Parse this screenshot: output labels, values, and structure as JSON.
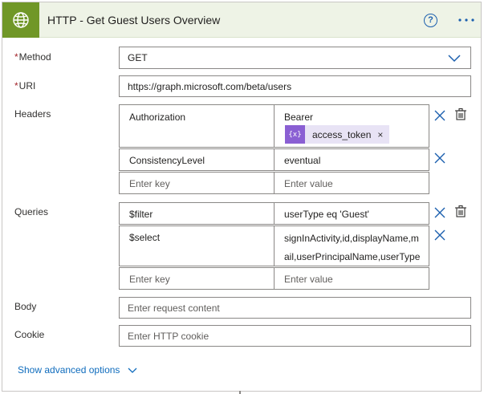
{
  "header": {
    "title": "HTTP - Get Guest Users Overview",
    "help_symbol": "?",
    "accent_color": "#709727",
    "icons": [
      "globe-icon",
      "help-icon",
      "more-options-icon"
    ]
  },
  "fields": {
    "method": {
      "required_mark": "*",
      "label": "Method",
      "value": "GET"
    },
    "uri": {
      "required_mark": "*",
      "label": "URI",
      "value": "https://graph.microsoft.com/beta/users"
    },
    "body": {
      "label": "Body",
      "placeholder": "Enter request content"
    },
    "cookie": {
      "label": "Cookie",
      "placeholder": "Enter HTTP cookie"
    }
  },
  "headers": {
    "label": "Headers",
    "rows": [
      {
        "key": "Authorization",
        "value": "Bearer"
      },
      {
        "key": "ConsistencyLevel",
        "value": "eventual"
      }
    ],
    "token": {
      "icon_text": "{x}",
      "label": "access_token",
      "remove": "×"
    },
    "new_key_placeholder": "Enter key",
    "new_value_placeholder": "Enter value"
  },
  "queries": {
    "label": "Queries",
    "rows": [
      {
        "key": "$filter",
        "value": "userType eq 'Guest'"
      },
      {
        "key": "$select",
        "value_line1": "signInActivity,id,displayName,m",
        "value_line2": "ail,userPrincipalName,userType"
      }
    ],
    "new_key_placeholder": "Enter key",
    "new_value_placeholder": "Enter value"
  },
  "footer": {
    "show_advanced": "Show advanced options"
  }
}
